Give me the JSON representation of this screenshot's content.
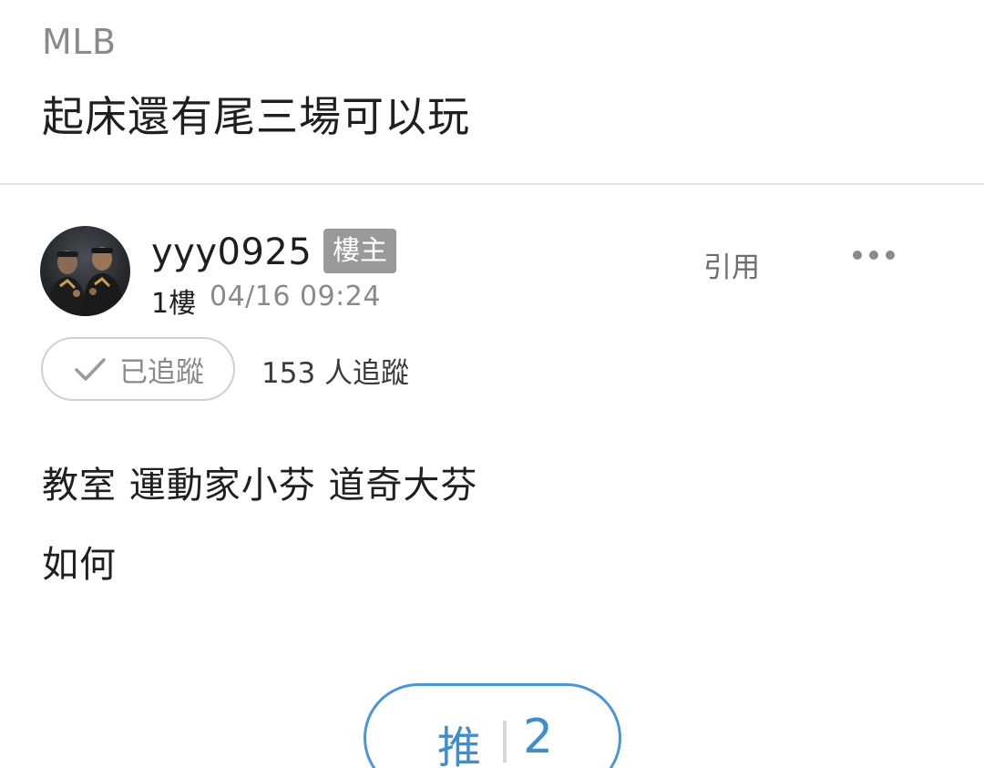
{
  "post": {
    "board": "MLB",
    "title": "起床還有尾三場可以玩"
  },
  "author": {
    "username": "yyy0925",
    "badge": "樓主",
    "floor": "1樓",
    "timestamp": "04/16 09:24",
    "avatar": "avatar-photo"
  },
  "actions": {
    "quote_label": "引用",
    "more_icon": "more-dots-icon"
  },
  "follow": {
    "button_label": "已追蹤",
    "check_icon": "check-icon",
    "followers_text": "153 人追蹤"
  },
  "content": {
    "lines": [
      "教室 運動家小芬 道奇大芬",
      "如何"
    ]
  },
  "push": {
    "label": "推",
    "count": "2",
    "color": "#3f8fd0"
  }
}
